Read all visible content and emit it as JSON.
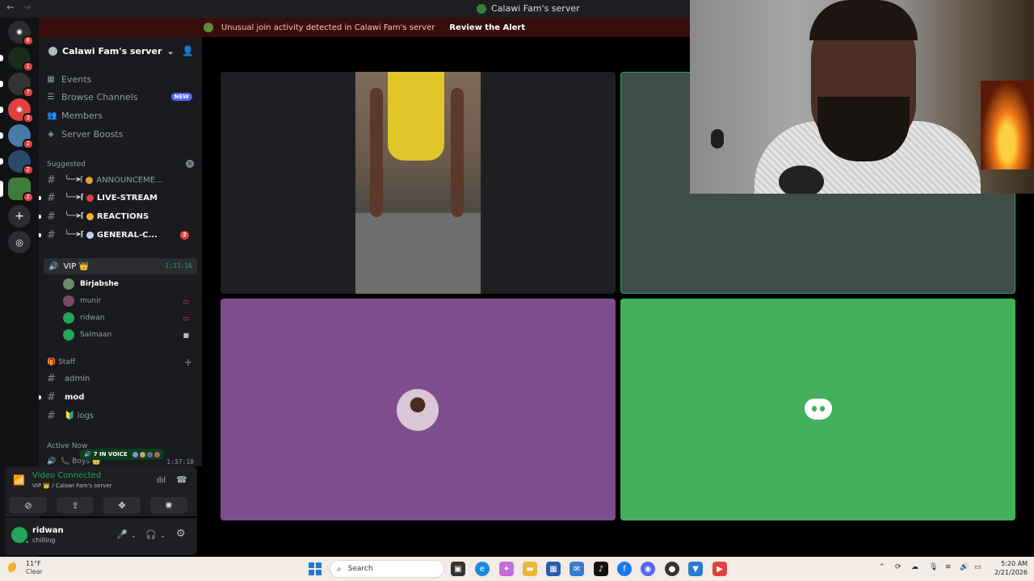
{
  "window": {
    "title": "Calawi Fam's server"
  },
  "alert": {
    "text": "Unusual join activity detected in Calawi Fam's server",
    "action": "Review the Alert"
  },
  "rail": [
    {
      "name": "discord-home",
      "color": "#2b2d31",
      "glyph": "◉",
      "badge": "6"
    },
    {
      "name": "server-1",
      "color": "#1c2a1c",
      "glyph": "",
      "badge": "1"
    },
    {
      "name": "server-2",
      "color": "#333",
      "glyph": "",
      "badge": "7"
    },
    {
      "name": "server-3",
      "color": "#e0413f",
      "glyph": "◉",
      "badge": "3"
    },
    {
      "name": "server-4",
      "color": "#4a7aa8",
      "glyph": "",
      "badge": "2"
    },
    {
      "name": "server-5",
      "color": "#2a4a6a",
      "glyph": "",
      "badge": "2"
    },
    {
      "name": "server-6",
      "color": "#3b7d3b",
      "glyph": "",
      "badge": "2"
    }
  ],
  "sidebar": {
    "server_name": "Calawi Fam's server",
    "menu": [
      {
        "label": "Events",
        "icon": "calendar-icon"
      },
      {
        "label": "Browse Channels",
        "icon": "browse-icon",
        "badge": "NEW"
      },
      {
        "label": "Members",
        "icon": "members-icon"
      },
      {
        "label": "Server Boosts",
        "icon": "boost-icon"
      }
    ],
    "suggested_label": "Suggested",
    "channels": [
      {
        "label": "ANNOUNCEME...",
        "emoji_color": "#e2a13a",
        "dim": true
      },
      {
        "label": "LIVE-STREAM",
        "emoji_color": "#e0413f"
      },
      {
        "label": "REACTIONS",
        "emoji_color": "#f0b23a"
      },
      {
        "label": "GENERAL-C...",
        "emoji_color": "#c9c9f0",
        "badge": "2"
      }
    ],
    "voice_channel": {
      "name": "VIP 👑",
      "timer": "1:33:16"
    },
    "voice_users": [
      {
        "name": "Birjabshe",
        "active": true,
        "avatar": "#6a8a6a"
      },
      {
        "name": "munir",
        "avatar": "#7a4a6a",
        "status": "screen"
      },
      {
        "name": "ridwan",
        "avatar": "#23a55a",
        "status": "screen"
      },
      {
        "name": "Salmaan",
        "avatar": "#23a55a",
        "status": "video"
      }
    ],
    "staff_label": "🎁 Staff",
    "staff_channels": [
      {
        "label": "admin"
      },
      {
        "label": "mod",
        "unread": true
      },
      {
        "label": "🔰 logs"
      }
    ],
    "active_now": "Active Now",
    "boys": {
      "label": "📞 Boys 👑",
      "timer": "1:37:10",
      "in_voice": "7 IN VOICE"
    }
  },
  "voice_panel": {
    "status": "Video Connected",
    "sub": "VIP 👑 / Calawi Fam's server"
  },
  "user": {
    "name": "ridwan",
    "status": "chilling"
  },
  "taskbar": {
    "weather_temp": "11°F",
    "weather_desc": "Clear",
    "search": "Search",
    "time": "5:20 AM",
    "date": "2/21/2026"
  }
}
